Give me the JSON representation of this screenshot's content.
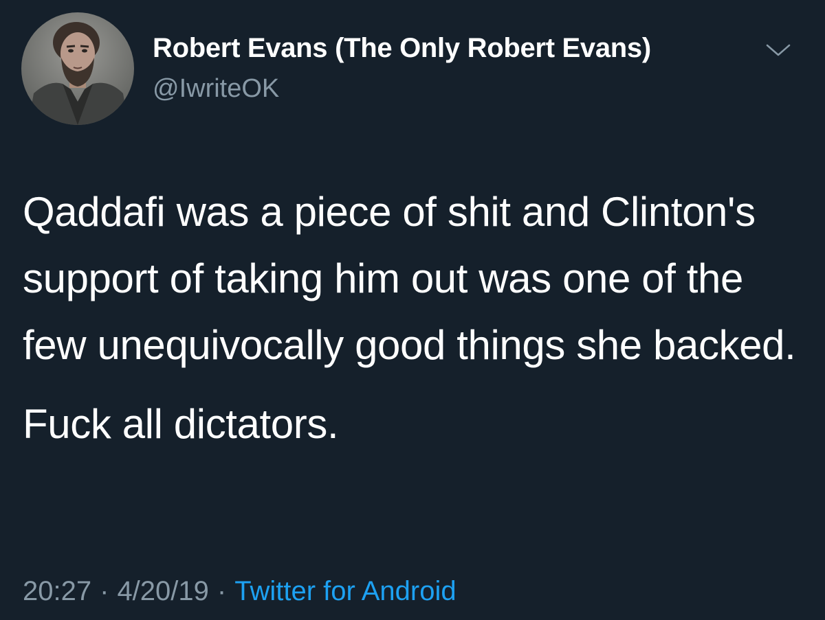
{
  "user": {
    "display_name": "Robert Evans (The Only Robert Evans)",
    "handle": "@IwriteOK",
    "avatar": "profile-photo"
  },
  "menu": {
    "icon": "chevron-down-icon"
  },
  "tweet": {
    "paragraphs": [
      "Qaddafi was a piece of shit and Clinton's support of taking him out was one of the few unequivocally good things she backed.",
      "Fuck all dictators."
    ]
  },
  "meta": {
    "time": "20:27",
    "separator": "·",
    "date": "4/20/19",
    "source": "Twitter for Android"
  },
  "colors": {
    "background": "#15202b",
    "text": "#ffffff",
    "secondary_text": "#8899a6",
    "link": "#1da1f2"
  }
}
